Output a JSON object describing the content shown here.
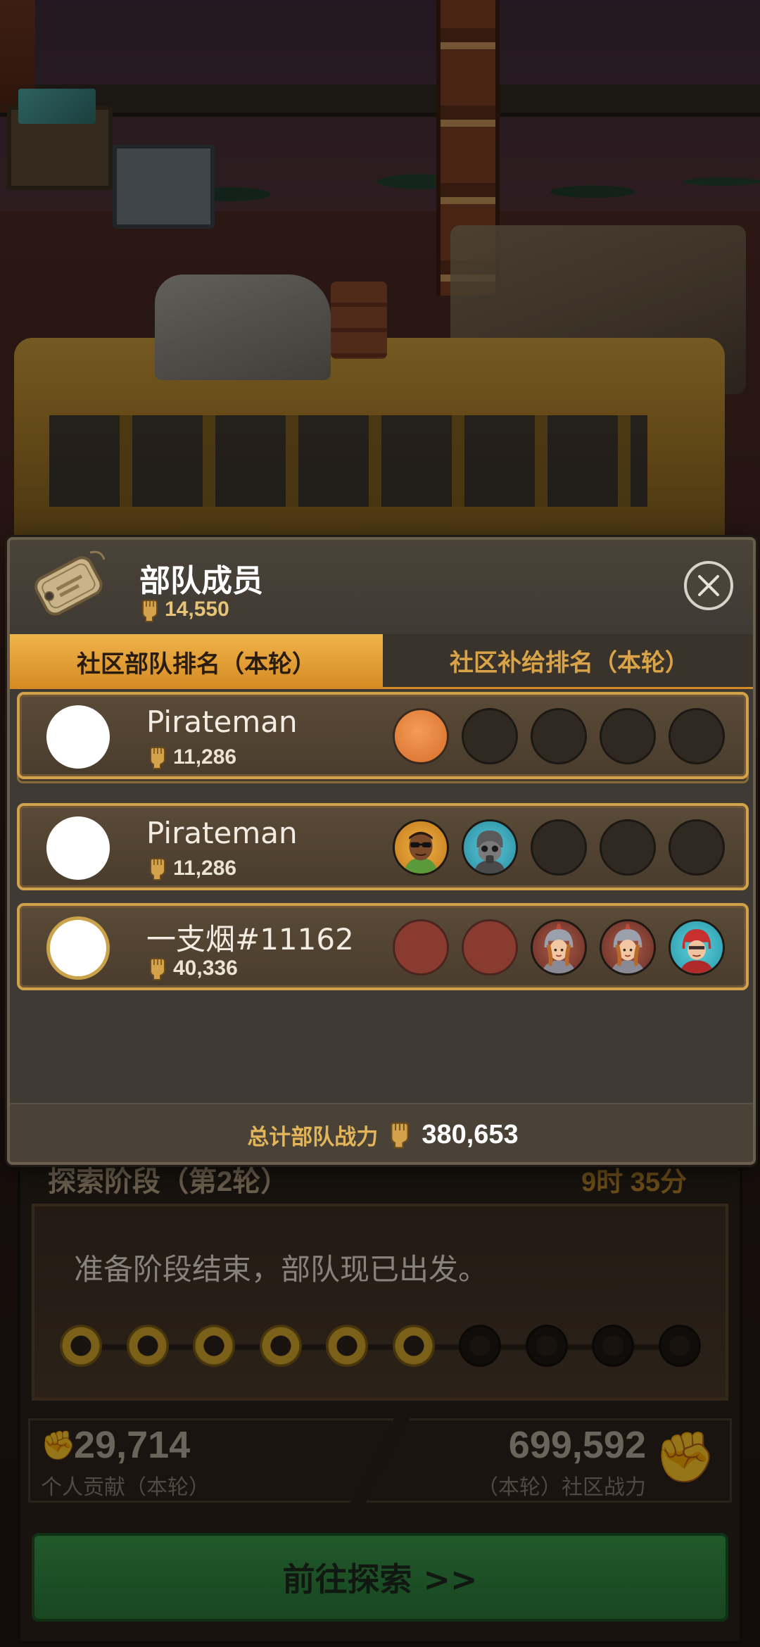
{
  "underlying": {
    "stage_title": "探索阶段（第2轮）",
    "stage_timer": "9时 35分",
    "stage_message": "准备阶段结束，部队现已出发。",
    "progress_nodes": {
      "completed": 6,
      "total": 10
    },
    "personal_contribution_value": "29,714",
    "personal_contribution_label": "个人贡献（本轮）",
    "community_power_value": "699,592",
    "community_power_label": "（本轮）社区战力",
    "explore_button_label": "前往探索 >>"
  },
  "modal": {
    "title": "部队成员",
    "power": "14,550",
    "tabs": [
      {
        "label": "社区部队排名（本轮）",
        "active": true
      },
      {
        "label": "社区补给排名（本轮）",
        "active": false
      }
    ],
    "members": [
      {
        "name": "Pirateman",
        "power": "11,286",
        "slots": [
          "orange",
          "empty",
          "empty",
          "empty",
          "empty"
        ]
      },
      {
        "name": "Pirateman",
        "power": "11,286",
        "slots": [
          "hero-sunglasses",
          "hero-gasmask",
          "empty",
          "empty",
          "empty"
        ]
      },
      {
        "name": "一支烟#11162",
        "power": "40,336",
        "slots": [
          "red",
          "red",
          "hero-knight-girl",
          "hero-knight-girl",
          "hero-red-helmet"
        ]
      }
    ],
    "footer_label": "总计部队战力",
    "footer_value": "380,653"
  },
  "colors": {
    "accent_gold": "#d48a22",
    "tab_active": "#f0b44a",
    "power_text": "#e6c377",
    "explore_green": "#2a7a38"
  },
  "icons": {
    "header": "dogtag-icon",
    "power": "fist-icon",
    "close": "close-icon"
  }
}
